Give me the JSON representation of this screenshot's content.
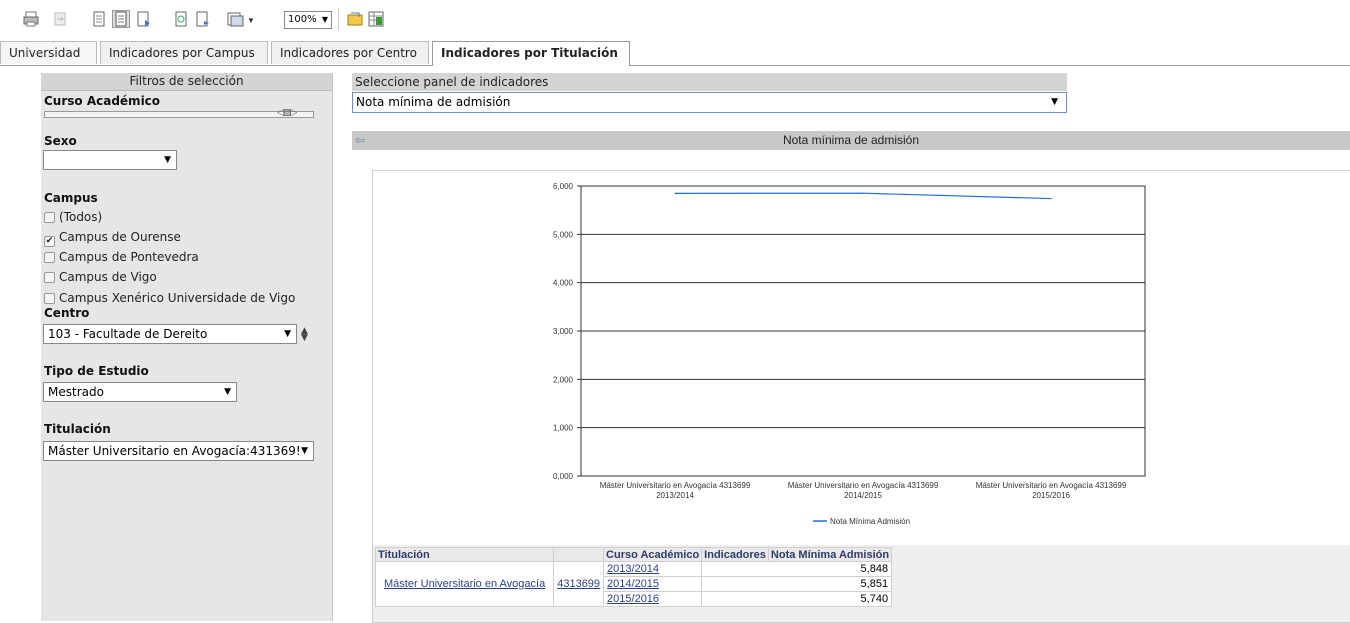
{
  "toolbar": {
    "icons": [
      "print-icon",
      "export-icon",
      "page-icon",
      "page-view-icon",
      "page-next-icon",
      "refresh-icon",
      "refresh-page-icon",
      "layout-icon",
      "zoom-icon",
      "excel-icon"
    ],
    "zoom_value": "100%"
  },
  "tabs": [
    {
      "label": "Universidad",
      "active": false
    },
    {
      "label": "Indicadores por Campus",
      "active": false
    },
    {
      "label": "Indicadores por Centro",
      "active": false
    },
    {
      "label": "Indicadores por Titulación",
      "active": true
    }
  ],
  "filters": {
    "title": "Filtros de selección",
    "curso_label": "Curso Académico",
    "sexo_label": "Sexo",
    "sexo_value": "",
    "campus_label": "Campus",
    "campus_options": [
      {
        "label": "(Todos)",
        "checked": false
      },
      {
        "label": "Campus de Ourense",
        "checked": true
      },
      {
        "label": "Campus de Pontevedra",
        "checked": false
      },
      {
        "label": "Campus de Vigo",
        "checked": false
      },
      {
        "label": "Campus Xenérico Universidade de Vigo",
        "checked": false
      }
    ],
    "centro_label": "Centro",
    "centro_value": "103 - Facultade de Dereito",
    "tipo_label": "Tipo de Estudio",
    "tipo_value": "Mestrado",
    "titulacion_label": "Titulación",
    "titulacion_value": "Máster Universitario en Avogacía:431369!"
  },
  "indicator_panel": {
    "label": "Seleccione panel de indicadores",
    "value": "Nota mínima de admisión"
  },
  "chart_panel_title": "Nota mínima de admisión",
  "chart_data": {
    "type": "line",
    "categories": [
      [
        "Máster Universitario en Avogacía 4313699",
        "2013/2014"
      ],
      [
        "Máster Universitario en Avogacía 4313699",
        "2014/2015"
      ],
      [
        "Máster Universitario en Avogacía 4313699",
        "2015/2016"
      ]
    ],
    "series": [
      {
        "name": "Nota Mínima Admisión",
        "values": [
          5.848,
          5.851,
          5.74
        ],
        "color": "#1f6fd6"
      }
    ],
    "y_ticks": [
      "0,000",
      "1,000",
      "2,000",
      "3,000",
      "4,000",
      "5,000",
      "6,000"
    ],
    "ylim": [
      0,
      6
    ],
    "grid": true,
    "legend": "bottom"
  },
  "table": {
    "headers": [
      "Titulación",
      "",
      "Curso Académico",
      "Indicadores",
      "Nota Mínima Admisión"
    ],
    "titulacion": "Máster Universitario en Avogacía",
    "codigo": "4313699",
    "rows": [
      {
        "curso": "2013/2014",
        "nota": "5,848"
      },
      {
        "curso": "2014/2015",
        "nota": "5,851"
      },
      {
        "curso": "2015/2016",
        "nota": "5,740"
      }
    ]
  }
}
